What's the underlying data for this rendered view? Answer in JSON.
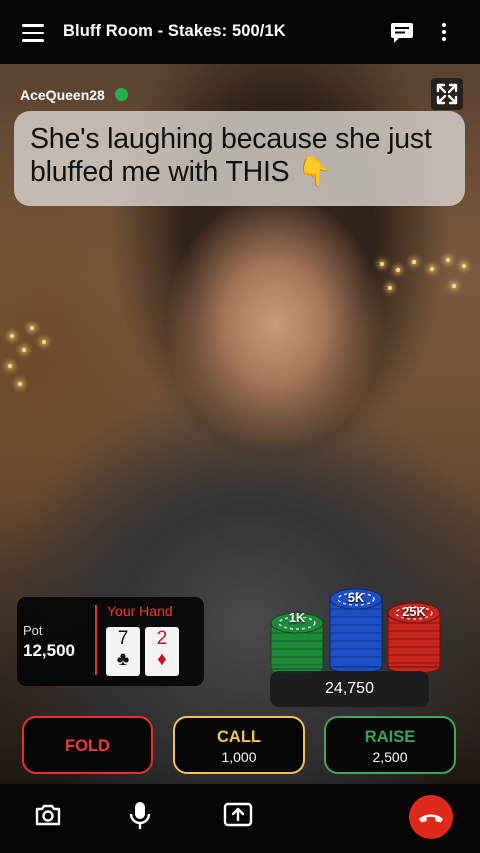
{
  "header": {
    "title": "Bluff Room - Stakes: 500/1K",
    "menu_icon": "hamburger-menu-icon",
    "chat_icon": "chat-bubble-icon",
    "more_icon": "more-vertical-icon"
  },
  "video": {
    "username": "AceQueen28",
    "status": "online",
    "status_color": "#22b14c",
    "expand_icon": "fullscreen-expand-icon",
    "caption": "She's laughing because she just bluffed me with THIS 👇"
  },
  "table": {
    "pot_label": "Pot",
    "pot_value": "12,500",
    "hand_label": "Your Hand",
    "cards": [
      {
        "rank": "7",
        "suit": "♣",
        "color": "#111111"
      },
      {
        "rank": "2",
        "suit": "♦",
        "color": "#c4122b"
      }
    ],
    "chip_stacks": [
      {
        "label": "1K",
        "color": "#1f8a3a"
      },
      {
        "label": "5K",
        "color": "#1d4fc4"
      },
      {
        "label": "25K",
        "color": "#c8241c"
      }
    ],
    "balance": "24,750"
  },
  "actions": {
    "fold": {
      "label": "FOLD",
      "color": "#e7302c"
    },
    "call": {
      "label": "CALL",
      "amount": "1,000",
      "color": "#f2c35a"
    },
    "raise": {
      "label": "RAISE",
      "amount": "2,500",
      "color": "#37a654"
    }
  },
  "bottom_bar": {
    "icons": [
      "camera-icon",
      "microphone-icon",
      "share-screen-icon",
      "end-call-icon"
    ],
    "end_call_color": "#dd2a1d"
  }
}
